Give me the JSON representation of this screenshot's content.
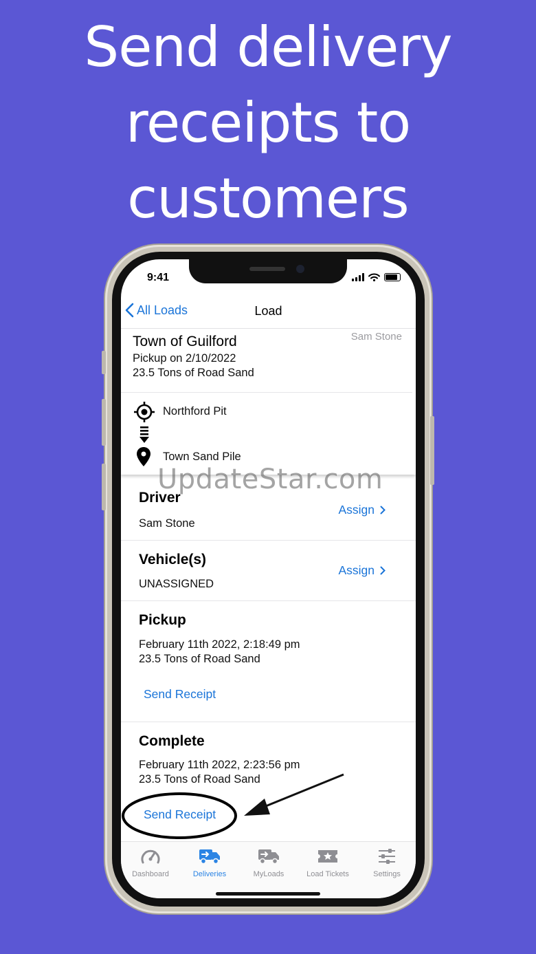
{
  "headline": [
    "Send delivery",
    "receipts to",
    "customers"
  ],
  "status_bar": {
    "time": "9:41"
  },
  "nav": {
    "back_label": "All Loads",
    "title": "Load"
  },
  "load_card": {
    "customer": "Town of Guilford",
    "driver_name": "Sam Stone",
    "pickup_date": "Pickup on 2/10/2022",
    "material": "23.5 Tons of Road Sand",
    "origin": "Northford Pit",
    "destination": "Town Sand Pile"
  },
  "watermark": "UpdateStar.com",
  "driver_section": {
    "title": "Driver",
    "value": "Sam Stone",
    "action": "Assign"
  },
  "vehicle_section": {
    "title": "Vehicle(s)",
    "value": "UNASSIGNED",
    "action": "Assign"
  },
  "pickup_section": {
    "title": "Pickup",
    "timestamp": "February 11th 2022, 2:18:49 pm",
    "material": "23.5 Tons of Road Sand",
    "action": "Send Receipt"
  },
  "complete_section": {
    "title": "Complete",
    "timestamp": "February 11th 2022, 2:23:56 pm",
    "material": "23.5 Tons of Road Sand",
    "action": "Send Receipt"
  },
  "tabs": [
    {
      "label": "Dashboard",
      "icon": "speedometer-icon"
    },
    {
      "label": "Deliveries",
      "icon": "delivery-truck-icon",
      "active": true
    },
    {
      "label": "MyLoads",
      "icon": "truck-icon"
    },
    {
      "label": "Load Tickets",
      "icon": "ticket-icon"
    },
    {
      "label": "Settings",
      "icon": "sliders-icon"
    }
  ],
  "colors": {
    "background": "#5b57d4",
    "accent": "#1a74d8",
    "tab_active": "#2b84e4"
  }
}
